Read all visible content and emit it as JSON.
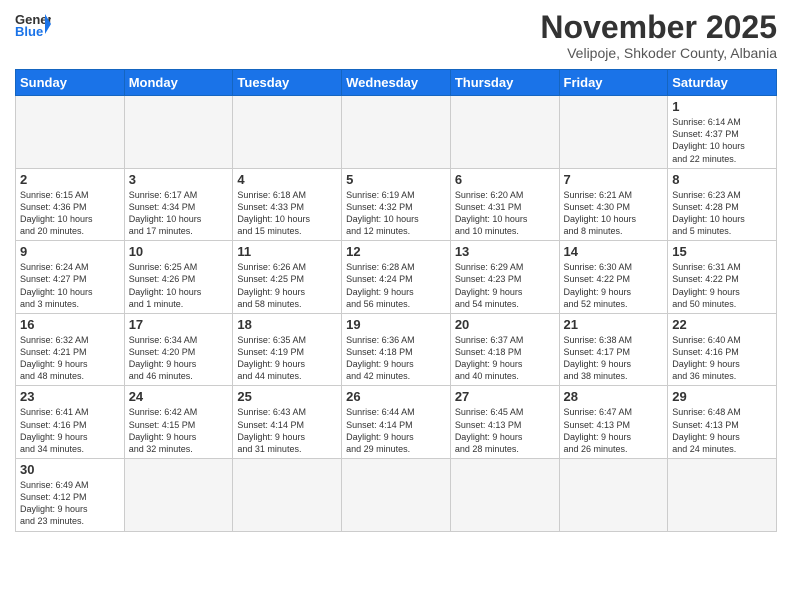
{
  "logo": {
    "text_general": "General",
    "text_blue": "Blue"
  },
  "title": "November 2025",
  "subtitle": "Velipoje, Shkoder County, Albania",
  "days_of_week": [
    "Sunday",
    "Monday",
    "Tuesday",
    "Wednesday",
    "Thursday",
    "Friday",
    "Saturday"
  ],
  "weeks": [
    [
      {
        "day": "",
        "info": ""
      },
      {
        "day": "",
        "info": ""
      },
      {
        "day": "",
        "info": ""
      },
      {
        "day": "",
        "info": ""
      },
      {
        "day": "",
        "info": ""
      },
      {
        "day": "",
        "info": ""
      },
      {
        "day": "1",
        "info": "Sunrise: 6:14 AM\nSunset: 4:37 PM\nDaylight: 10 hours\nand 22 minutes."
      }
    ],
    [
      {
        "day": "2",
        "info": "Sunrise: 6:15 AM\nSunset: 4:36 PM\nDaylight: 10 hours\nand 20 minutes."
      },
      {
        "day": "3",
        "info": "Sunrise: 6:17 AM\nSunset: 4:34 PM\nDaylight: 10 hours\nand 17 minutes."
      },
      {
        "day": "4",
        "info": "Sunrise: 6:18 AM\nSunset: 4:33 PM\nDaylight: 10 hours\nand 15 minutes."
      },
      {
        "day": "5",
        "info": "Sunrise: 6:19 AM\nSunset: 4:32 PM\nDaylight: 10 hours\nand 12 minutes."
      },
      {
        "day": "6",
        "info": "Sunrise: 6:20 AM\nSunset: 4:31 PM\nDaylight: 10 hours\nand 10 minutes."
      },
      {
        "day": "7",
        "info": "Sunrise: 6:21 AM\nSunset: 4:30 PM\nDaylight: 10 hours\nand 8 minutes."
      },
      {
        "day": "8",
        "info": "Sunrise: 6:23 AM\nSunset: 4:28 PM\nDaylight: 10 hours\nand 5 minutes."
      }
    ],
    [
      {
        "day": "9",
        "info": "Sunrise: 6:24 AM\nSunset: 4:27 PM\nDaylight: 10 hours\nand 3 minutes."
      },
      {
        "day": "10",
        "info": "Sunrise: 6:25 AM\nSunset: 4:26 PM\nDaylight: 10 hours\nand 1 minute."
      },
      {
        "day": "11",
        "info": "Sunrise: 6:26 AM\nSunset: 4:25 PM\nDaylight: 9 hours\nand 58 minutes."
      },
      {
        "day": "12",
        "info": "Sunrise: 6:28 AM\nSunset: 4:24 PM\nDaylight: 9 hours\nand 56 minutes."
      },
      {
        "day": "13",
        "info": "Sunrise: 6:29 AM\nSunset: 4:23 PM\nDaylight: 9 hours\nand 54 minutes."
      },
      {
        "day": "14",
        "info": "Sunrise: 6:30 AM\nSunset: 4:22 PM\nDaylight: 9 hours\nand 52 minutes."
      },
      {
        "day": "15",
        "info": "Sunrise: 6:31 AM\nSunset: 4:22 PM\nDaylight: 9 hours\nand 50 minutes."
      }
    ],
    [
      {
        "day": "16",
        "info": "Sunrise: 6:32 AM\nSunset: 4:21 PM\nDaylight: 9 hours\nand 48 minutes."
      },
      {
        "day": "17",
        "info": "Sunrise: 6:34 AM\nSunset: 4:20 PM\nDaylight: 9 hours\nand 46 minutes."
      },
      {
        "day": "18",
        "info": "Sunrise: 6:35 AM\nSunset: 4:19 PM\nDaylight: 9 hours\nand 44 minutes."
      },
      {
        "day": "19",
        "info": "Sunrise: 6:36 AM\nSunset: 4:18 PM\nDaylight: 9 hours\nand 42 minutes."
      },
      {
        "day": "20",
        "info": "Sunrise: 6:37 AM\nSunset: 4:18 PM\nDaylight: 9 hours\nand 40 minutes."
      },
      {
        "day": "21",
        "info": "Sunrise: 6:38 AM\nSunset: 4:17 PM\nDaylight: 9 hours\nand 38 minutes."
      },
      {
        "day": "22",
        "info": "Sunrise: 6:40 AM\nSunset: 4:16 PM\nDaylight: 9 hours\nand 36 minutes."
      }
    ],
    [
      {
        "day": "23",
        "info": "Sunrise: 6:41 AM\nSunset: 4:16 PM\nDaylight: 9 hours\nand 34 minutes."
      },
      {
        "day": "24",
        "info": "Sunrise: 6:42 AM\nSunset: 4:15 PM\nDaylight: 9 hours\nand 32 minutes."
      },
      {
        "day": "25",
        "info": "Sunrise: 6:43 AM\nSunset: 4:14 PM\nDaylight: 9 hours\nand 31 minutes."
      },
      {
        "day": "26",
        "info": "Sunrise: 6:44 AM\nSunset: 4:14 PM\nDaylight: 9 hours\nand 29 minutes."
      },
      {
        "day": "27",
        "info": "Sunrise: 6:45 AM\nSunset: 4:13 PM\nDaylight: 9 hours\nand 28 minutes."
      },
      {
        "day": "28",
        "info": "Sunrise: 6:47 AM\nSunset: 4:13 PM\nDaylight: 9 hours\nand 26 minutes."
      },
      {
        "day": "29",
        "info": "Sunrise: 6:48 AM\nSunset: 4:13 PM\nDaylight: 9 hours\nand 24 minutes."
      }
    ],
    [
      {
        "day": "30",
        "info": "Sunrise: 6:49 AM\nSunset: 4:12 PM\nDaylight: 9 hours\nand 23 minutes."
      },
      {
        "day": "",
        "info": ""
      },
      {
        "day": "",
        "info": ""
      },
      {
        "day": "",
        "info": ""
      },
      {
        "day": "",
        "info": ""
      },
      {
        "day": "",
        "info": ""
      },
      {
        "day": "",
        "info": ""
      }
    ]
  ]
}
